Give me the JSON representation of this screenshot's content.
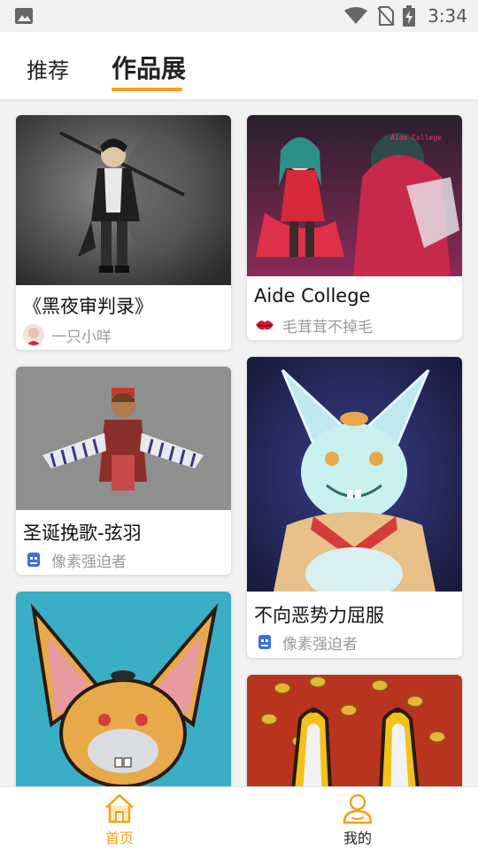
{
  "status_bar": {
    "time": "3:34",
    "icons": [
      "image-notification-icon",
      "wifi-icon",
      "no-sim-icon",
      "battery-charging-icon"
    ]
  },
  "header": {
    "tabs": [
      {
        "label": "推荐",
        "active": false
      },
      {
        "label": "作品展",
        "active": true
      }
    ],
    "accent_color": "#f4a118"
  },
  "works": {
    "left": [
      {
        "title": "《黑夜审判录》",
        "author": "一只小咩",
        "art": "dark-swordsman-illustration"
      },
      {
        "title": "圣诞挽歌-弦羽",
        "author": "像素强迫者",
        "art": "christmas-winged-character"
      },
      {
        "title": "",
        "author": "",
        "art": "rabbit-character-teal"
      }
    ],
    "right": [
      {
        "title": "Aide College",
        "author": "毛茸茸不掉毛",
        "art": "anime-girls-illustration",
        "art_caption": "Aide College"
      },
      {
        "title": "不向恶势力屈服",
        "author": "像素强迫者",
        "art": "ice-rabbit-character"
      },
      {
        "title": "",
        "author": "",
        "art": "rabbit-with-coins"
      }
    ]
  },
  "bottom_nav": {
    "items": [
      {
        "label": "首页",
        "icon": "home-icon",
        "active": true
      },
      {
        "label": "我的",
        "icon": "user-icon",
        "active": false
      }
    ]
  }
}
